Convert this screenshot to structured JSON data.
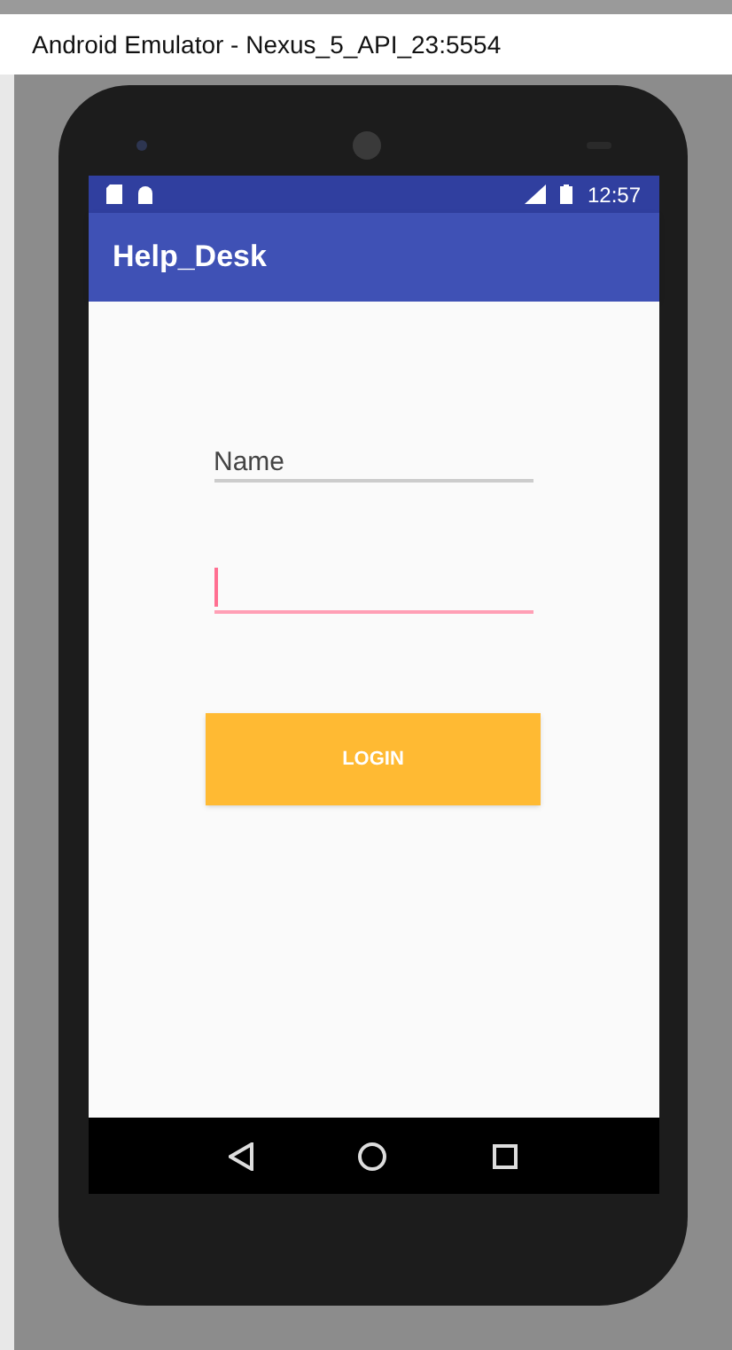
{
  "window": {
    "title": "Android Emulator - Nexus_5_API_23:5554"
  },
  "status_bar": {
    "time": "12:57"
  },
  "app_bar": {
    "title": "Help_Desk"
  },
  "fields": [
    {
      "placeholder": "Name",
      "focused": false
    },
    {
      "focused": true
    }
  ],
  "button": {
    "label": "LOGIN"
  }
}
